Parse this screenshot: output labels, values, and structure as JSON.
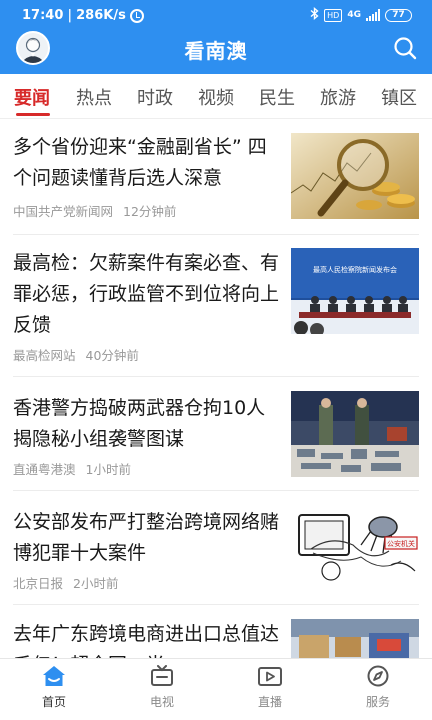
{
  "status_bar": {
    "time": "17:40",
    "speed": "286K/s",
    "separator": "|",
    "alarm_icon": "alarm-clock-icon",
    "bluetooth_icon": "bluetooth-icon",
    "hd": "HD",
    "network": "4G",
    "battery": "77"
  },
  "header": {
    "title": "看南澳",
    "avatar_icon": "user-avatar-icon",
    "search_icon": "search-icon",
    "bg_color": "#2e8ff0"
  },
  "tabs": [
    {
      "label": "要闻",
      "active": true
    },
    {
      "label": "热点"
    },
    {
      "label": "时政"
    },
    {
      "label": "视频"
    },
    {
      "label": "民生"
    },
    {
      "label": "旅游"
    },
    {
      "label": "镇区"
    }
  ],
  "accent_color": "#d72a2a",
  "news": [
    {
      "title": "多个省份迎来“金融副省长” 四个问题读懂背后选人深意",
      "source": "中国共产党新闻网",
      "time": "12分钟前",
      "image": "gold-coins-magnifier-photo"
    },
    {
      "title": "最高检：欠薪案件有案必查、有罪必惩，行政监管不到位将向上反馈",
      "source": "最高检网站",
      "time": "40分钟前",
      "image": "press-conference-photo",
      "image_caption": "最高人民检察院新闻发布会"
    },
    {
      "title": "香港警方捣破两武器仓拘10人 揭隐秘小组袭警图谋",
      "source": "直通粤港澳",
      "time": "1小时前",
      "image": "police-seized-weapons-photo"
    },
    {
      "title": "公安部发布严打整治跨境网络赌博犯罪十大案件",
      "source": "北京日报",
      "time": "2小时前",
      "image": "gambling-cartoon-illustration",
      "image_caption": "公安机关"
    },
    {
      "title": "去年广东跨境电商进出口总值达千亿！超全国一半",
      "source": "",
      "time": "",
      "image": "warehouse-photo"
    }
  ],
  "bottom_nav": [
    {
      "label": "首页",
      "icon": "home-icon",
      "active": true
    },
    {
      "label": "电视",
      "icon": "tv-icon"
    },
    {
      "label": "直播",
      "icon": "live-video-icon"
    },
    {
      "label": "服务",
      "icon": "compass-icon"
    }
  ]
}
